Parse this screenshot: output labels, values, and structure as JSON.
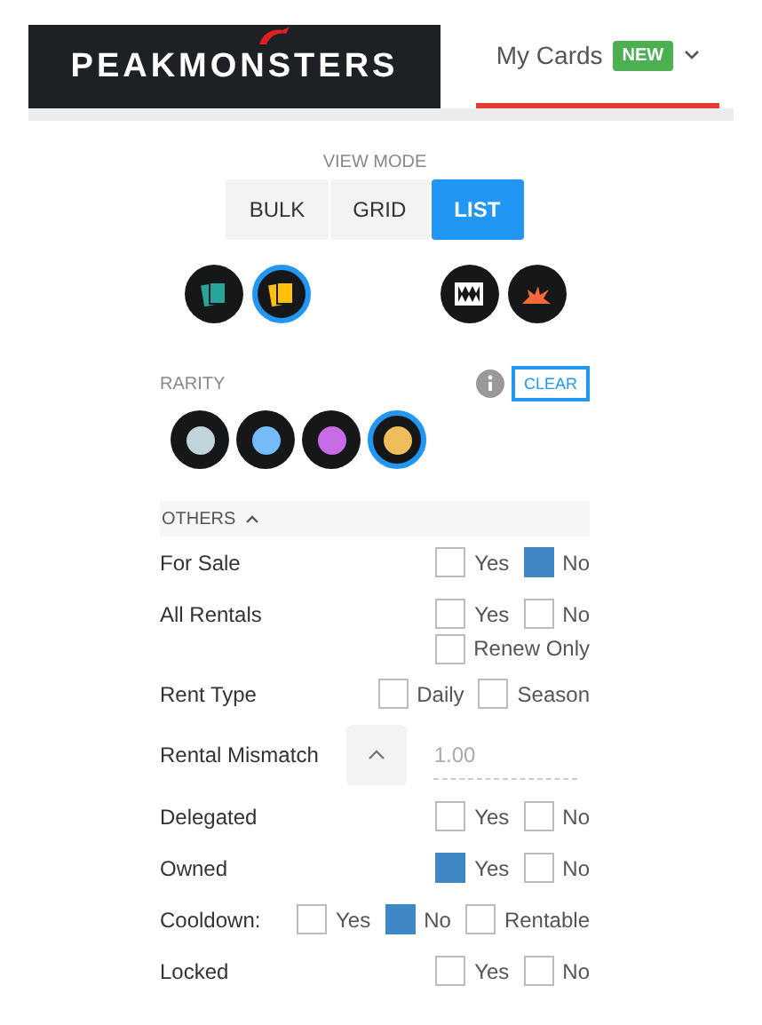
{
  "header": {
    "logo": "PEAKMONSTERS",
    "nav": {
      "label": "My Cards",
      "badge": "NEW",
      "selected": true
    }
  },
  "view_mode": {
    "title": "VIEW MODE",
    "options": [
      {
        "label": "BULK",
        "selected": false
      },
      {
        "label": "GRID",
        "selected": false
      },
      {
        "label": "LIST",
        "selected": true
      }
    ]
  },
  "card_filters": [
    {
      "kind": "cards",
      "color": "#26a69a",
      "selected": false
    },
    {
      "kind": "cards",
      "color": "#ffc107",
      "selected": true
    },
    {
      "kind": "gap"
    },
    {
      "kind": "jaws",
      "selected": false
    },
    {
      "kind": "blast",
      "selected": false
    }
  ],
  "rarity": {
    "title": "RARITY",
    "clear": "CLEAR",
    "options": [
      {
        "color": "#c0d4dc",
        "selected": false
      },
      {
        "color": "#74bcf8",
        "selected": false
      },
      {
        "color": "#c56ce6",
        "selected": false
      },
      {
        "color": "#f0bd58",
        "selected": true
      }
    ]
  },
  "others": {
    "title": "OTHERS",
    "expanded": true,
    "rows": [
      {
        "kind": "checks",
        "label": "For Sale",
        "options": [
          {
            "label": "Yes",
            "checked": false
          },
          {
            "label": "No",
            "checked": true
          }
        ]
      },
      {
        "kind": "checks",
        "label": "All Rentals",
        "options": [
          {
            "label": "Yes",
            "checked": false
          },
          {
            "label": "No",
            "checked": false
          }
        ]
      },
      {
        "kind": "checks",
        "options": [
          {
            "label": "Renew Only",
            "checked": false
          }
        ]
      },
      {
        "kind": "checks",
        "label": "Rent Type",
        "options": [
          {
            "label": "Daily",
            "checked": false
          },
          {
            "label": "Season",
            "checked": false
          }
        ]
      },
      {
        "kind": "number",
        "label": "Rental Mismatch",
        "placeholder": "1.00"
      },
      {
        "kind": "checks",
        "label": "Delegated",
        "options": [
          {
            "label": "Yes",
            "checked": false
          },
          {
            "label": "No",
            "checked": false
          }
        ]
      },
      {
        "kind": "checks",
        "label": "Owned",
        "options": [
          {
            "label": "Yes",
            "checked": true
          },
          {
            "label": "No",
            "checked": false
          }
        ]
      },
      {
        "kind": "checks",
        "label": "Cooldown:",
        "options": [
          {
            "label": "Yes",
            "checked": false
          },
          {
            "label": "No",
            "checked": true
          },
          {
            "label": "Rentable",
            "checked": false
          }
        ]
      },
      {
        "kind": "checks",
        "label": "Locked",
        "options": [
          {
            "label": "Yes",
            "checked": false
          },
          {
            "label": "No",
            "checked": false
          }
        ]
      }
    ]
  }
}
